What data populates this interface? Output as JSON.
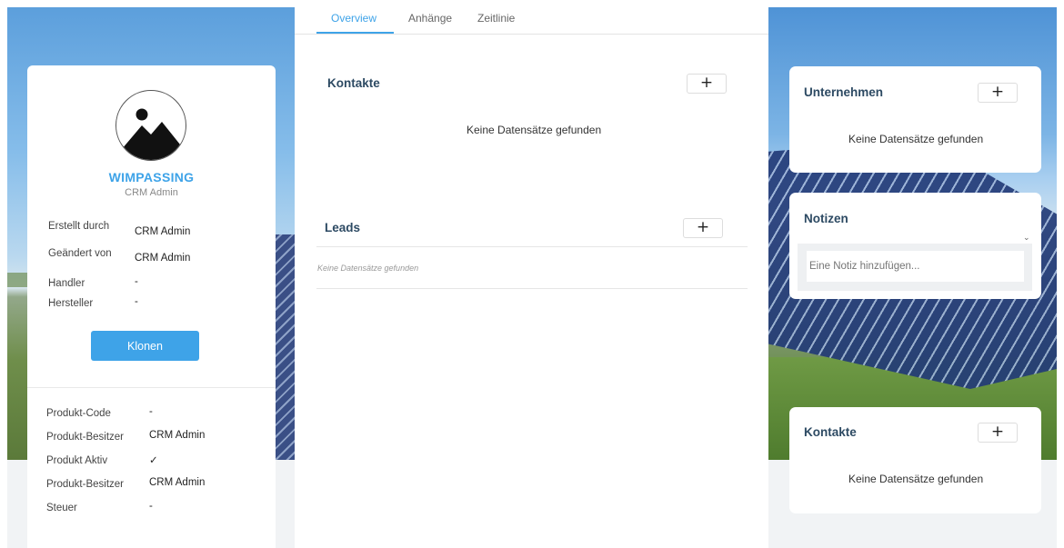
{
  "left_card": {
    "company_name": "WIMPASSING",
    "company_sub": "CRM Admin",
    "info": [
      {
        "label": "Erstellt durch",
        "value": "CRM Admin"
      },
      {
        "label": "Geändert von",
        "value": "CRM Admin"
      },
      {
        "label": "Handler",
        "value": "-"
      },
      {
        "label": "Hersteller",
        "value": "-"
      }
    ],
    "clone_label": "Klonen",
    "product_fields": [
      {
        "label": "Produkt-Code",
        "value": "-"
      },
      {
        "label": "Produkt-Besitzer",
        "value": "CRM Admin"
      },
      {
        "label": "Produkt Aktiv",
        "value": "✓"
      },
      {
        "label": "Produkt-Besitzer",
        "value": "CRM Admin"
      },
      {
        "label": "Steuer",
        "value": "-"
      }
    ]
  },
  "tabs": [
    {
      "label": "Overview",
      "active": true
    },
    {
      "label": "Anhänge",
      "active": false
    },
    {
      "label": "Zeitlinie",
      "active": false
    }
  ],
  "center": {
    "contacts_title": "Kontakte",
    "contacts_empty": "Keine Datensätze gefunden",
    "leads_title": "Leads",
    "leads_empty": "Keine Datensätze gefunden",
    "add_symbol": "+"
  },
  "right": {
    "companies_title": "Unternehmen",
    "companies_empty": "Keine Datensätze gefunden",
    "notes_title": "Notizen",
    "notes_placeholder": "Eine Notiz hinzufügen...",
    "contacts_title": "Kontakte",
    "contacts_empty": "Keine Datensätze gefunden",
    "add_symbol": "+",
    "collapse_symbol": "⌄"
  },
  "colors": {
    "accent": "#3ea3e8",
    "heading": "#2d4a63"
  }
}
